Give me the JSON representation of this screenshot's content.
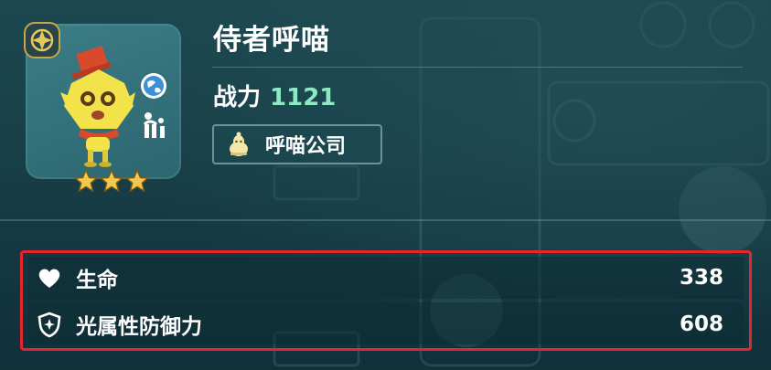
{
  "character": {
    "name": "侍者呼喵",
    "power_label": "战力",
    "power_value": "1121",
    "faction_label": "呼喵公司",
    "stars": 3
  },
  "stats": [
    {
      "label": "生命",
      "value": "338",
      "icon": "heart-icon"
    },
    {
      "label": "光属性防御力",
      "value": "608",
      "icon": "light-shield-icon"
    }
  ],
  "colors": {
    "power_value": "#8fe8c4",
    "highlight_border": "#e3272a",
    "star": "#f2c94c",
    "background": "#173a43"
  },
  "icons": {
    "rank": "compass-star-icon",
    "element_badge": "globe-icon",
    "type_badge": "mecha-icon",
    "faction": "bell-mascot-icon"
  }
}
